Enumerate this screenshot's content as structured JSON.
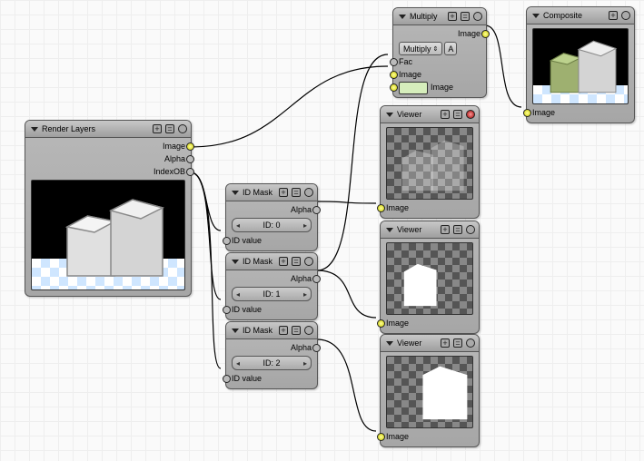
{
  "nodes": {
    "render_layers": {
      "title": "Render Layers",
      "outputs": {
        "image": "Image",
        "alpha": "Alpha",
        "indexob": "IndexOB"
      }
    },
    "id_mask_0": {
      "title": "ID Mask",
      "out": "Alpha",
      "spinner_label": "ID: 0",
      "in": "ID value"
    },
    "id_mask_1": {
      "title": "ID Mask",
      "out": "Alpha",
      "spinner_label": "ID: 1",
      "in": "ID value"
    },
    "id_mask_2": {
      "title": "ID Mask",
      "out": "Alpha",
      "spinner_label": "ID: 2",
      "in": "ID value"
    },
    "multiply": {
      "title": "Multiply",
      "out": "Image",
      "mode": "Multiply",
      "inputs": {
        "fac": "Fac",
        "image1": "Image",
        "image2": "Image"
      }
    },
    "viewer0": {
      "title": "Viewer",
      "out": "Image"
    },
    "viewer1": {
      "title": "Viewer",
      "out": "Image"
    },
    "viewer2": {
      "title": "Viewer",
      "out": "Image"
    },
    "composite": {
      "title": "Composite",
      "out": "Image"
    }
  }
}
